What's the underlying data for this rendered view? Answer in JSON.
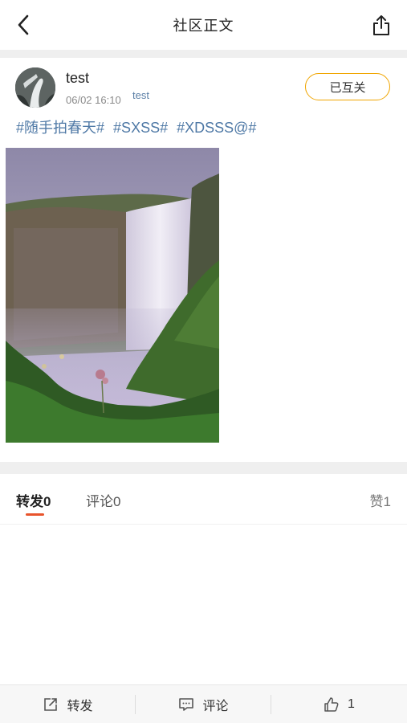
{
  "header": {
    "title": "社区正文",
    "back_icon": "back-arrow-icon",
    "share_icon": "share-icon"
  },
  "post": {
    "author": "test",
    "time": "06/02 16:10",
    "source": "test",
    "follow_label": "已互关",
    "tags": [
      "#随手拍春天#",
      "#SXSS#",
      "#XDSSS@#"
    ],
    "image": "waterfall-photo"
  },
  "tabs": {
    "forward": "转发0",
    "comment": "评论0",
    "like": "赞1"
  },
  "bottom_bar": {
    "forward_label": "转发",
    "comment_label": "评论",
    "like_count": "1"
  },
  "colors": {
    "accent": "#e8542c",
    "follow_border": "#f0a500",
    "tag_blue": "#4f79a6"
  }
}
